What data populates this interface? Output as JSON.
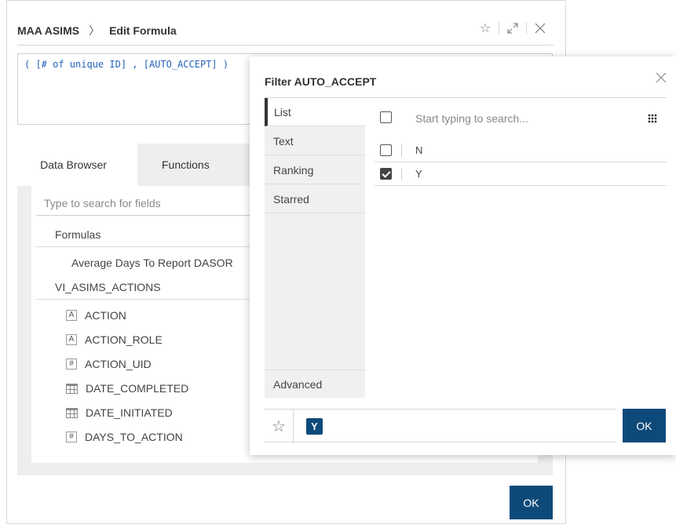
{
  "header": {
    "breadcrumb_root": "MAA ASIMS",
    "breadcrumb_separator": "〉",
    "title": "Edit Formula",
    "icons": [
      "star-outline-icon",
      "expand-icon",
      "close-icon"
    ]
  },
  "formula": {
    "text": "( [# of unique ID] , [AUTO_ACCEPT] )"
  },
  "tabs": [
    {
      "label": "Data Browser",
      "active": true
    },
    {
      "label": "Functions",
      "active": false
    }
  ],
  "browser": {
    "search_placeholder": "Type to search for fields",
    "groups": [
      {
        "label": "Formulas",
        "items": [
          {
            "label": "Average Days To Report DASOR",
            "type": "formula"
          }
        ]
      },
      {
        "label": "VI_ASIMS_ACTIONS",
        "items": [
          {
            "label": "ACTION",
            "type": "text",
            "icon_text": "A"
          },
          {
            "label": "ACTION_ROLE",
            "type": "text",
            "icon_text": "A"
          },
          {
            "label": "ACTION_UID",
            "type": "number",
            "icon_text": "#"
          },
          {
            "label": "DATE_COMPLETED",
            "type": "date",
            "icon_text": ""
          },
          {
            "label": "DATE_INITIATED",
            "type": "date",
            "icon_text": ""
          },
          {
            "label": "DAYS_TO_ACTION",
            "type": "number",
            "icon_text": "#"
          }
        ]
      }
    ]
  },
  "main_ok": "OK",
  "filter_popup": {
    "title": "Filter AUTO_ACCEPT",
    "side_tabs": [
      "List",
      "Text",
      "Ranking",
      "Starred"
    ],
    "advanced": "Advanced",
    "search_placeholder": "Start typing to search...",
    "options": [
      {
        "label": "N",
        "checked": false
      },
      {
        "label": "Y",
        "checked": true
      }
    ],
    "selected_chip": "Y",
    "ok": "OK"
  },
  "colors": {
    "primary_button": "#0d4a7a",
    "formula_text": "#2563b8"
  }
}
